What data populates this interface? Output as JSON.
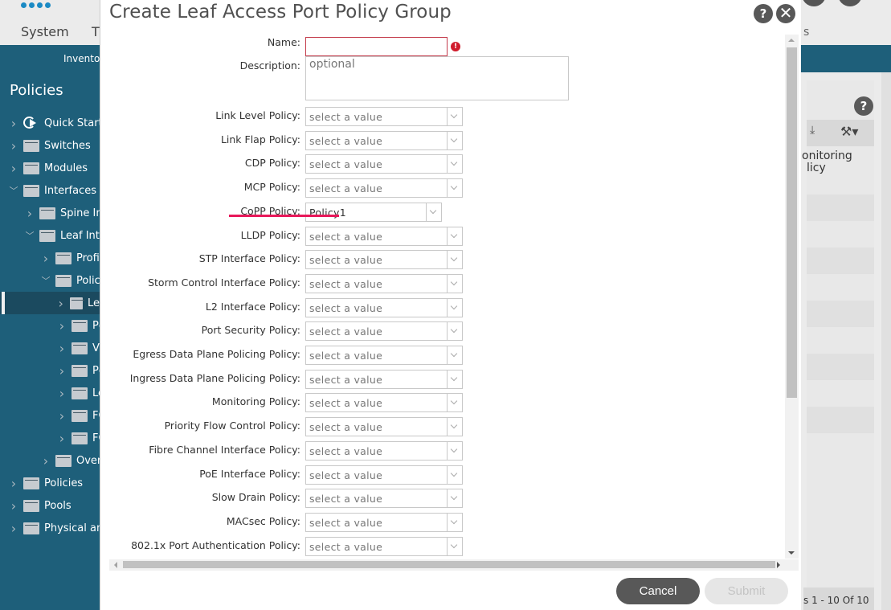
{
  "app": {
    "topnav": [
      "System",
      "T",
      "s"
    ],
    "subnav_item": "Invento",
    "sidebar_title": "Policies",
    "sidebar": [
      {
        "label": "Quick Start",
        "icon": "quick-start-icon",
        "expanded": false,
        "level": 0
      },
      {
        "label": "Switches",
        "icon": "folder-icon",
        "expanded": false,
        "level": 0
      },
      {
        "label": "Modules",
        "icon": "folder-icon",
        "expanded": false,
        "level": 0
      },
      {
        "label": "Interfaces",
        "icon": "folder-icon",
        "expanded": true,
        "level": 0
      },
      {
        "label": "Spine Int",
        "icon": "folder-icon",
        "expanded": false,
        "level": 1
      },
      {
        "label": "Leaf Inte",
        "icon": "folder-icon",
        "expanded": true,
        "level": 1
      },
      {
        "label": "Profil",
        "icon": "folder-icon",
        "expanded": false,
        "level": 2
      },
      {
        "label": "Polic",
        "icon": "folder-icon",
        "expanded": true,
        "level": 2
      },
      {
        "label": "Le",
        "icon": "folder-icon",
        "expanded": false,
        "level": 3,
        "selected": true
      },
      {
        "label": "Pc",
        "icon": "folder-icon",
        "expanded": false,
        "level": 3
      },
      {
        "label": "VI",
        "icon": "folder-icon",
        "expanded": false,
        "level": 3
      },
      {
        "label": "Pc",
        "icon": "folder-icon",
        "expanded": false,
        "level": 3
      },
      {
        "label": "Le",
        "icon": "folder-icon",
        "expanded": false,
        "level": 3
      },
      {
        "label": "FC",
        "icon": "folder-icon",
        "expanded": false,
        "level": 3
      },
      {
        "label": "FC",
        "icon": "folder-icon",
        "expanded": false,
        "level": 3
      },
      {
        "label": "Over",
        "icon": "folder-icon",
        "expanded": false,
        "level": 2
      },
      {
        "label": "Policies",
        "icon": "folder-icon",
        "expanded": false,
        "level": 0
      },
      {
        "label": "Pools",
        "icon": "folder-icon",
        "expanded": false,
        "level": 0
      },
      {
        "label": "Physical and",
        "icon": "folder-icon",
        "expanded": false,
        "level": 0
      }
    ],
    "right_panel": {
      "column_header_line1": "onitoring",
      "column_header_line2": "licy",
      "pager": "s 1 - 10 Of 10",
      "help_label": "?",
      "download_icon": "⤓",
      "tools_icon": "⚒▾"
    }
  },
  "modal": {
    "title": "Create Leaf Access Port Policy Group",
    "help_label": "?",
    "close_label": "✕",
    "name_label": "Name:",
    "name_value": "",
    "name_error_icon": "!",
    "description_label": "Description:",
    "description_placeholder": "optional",
    "fields": [
      {
        "label": "Link Level Policy:",
        "value": "select a value"
      },
      {
        "label": "Link Flap Policy:",
        "value": "select a value"
      },
      {
        "label": "CDP Policy:",
        "value": "select a value"
      },
      {
        "label": "MCP Policy:",
        "value": "select a value"
      },
      {
        "label": "CoPP Policy:",
        "value": "Policy1",
        "filled": true
      },
      {
        "label": "LLDP Policy:",
        "value": "select a value"
      },
      {
        "label": "STP Interface Policy:",
        "value": "select a value"
      },
      {
        "label": "Storm Control Interface Policy:",
        "value": "select a value"
      },
      {
        "label": "L2 Interface Policy:",
        "value": "select a value"
      },
      {
        "label": "Port Security Policy:",
        "value": "select a value"
      },
      {
        "label": "Egress Data Plane Policing Policy:",
        "value": "select a value"
      },
      {
        "label": "Ingress Data Plane Policing Policy:",
        "value": "select a value"
      },
      {
        "label": "Monitoring Policy:",
        "value": "select a value"
      },
      {
        "label": "Priority Flow Control Policy:",
        "value": "select a value"
      },
      {
        "label": "Fibre Channel Interface Policy:",
        "value": "select a value"
      },
      {
        "label": "PoE Interface Policy:",
        "value": "select a value"
      },
      {
        "label": "Slow Drain Policy:",
        "value": "select a value"
      },
      {
        "label": "MACsec Policy:",
        "value": "select a value"
      },
      {
        "label": "802.1x Port Authentication Policy:",
        "value": "select a value"
      }
    ],
    "cancel_label": "Cancel",
    "submit_label": "Submit",
    "highlight_color": "#e8185a"
  }
}
